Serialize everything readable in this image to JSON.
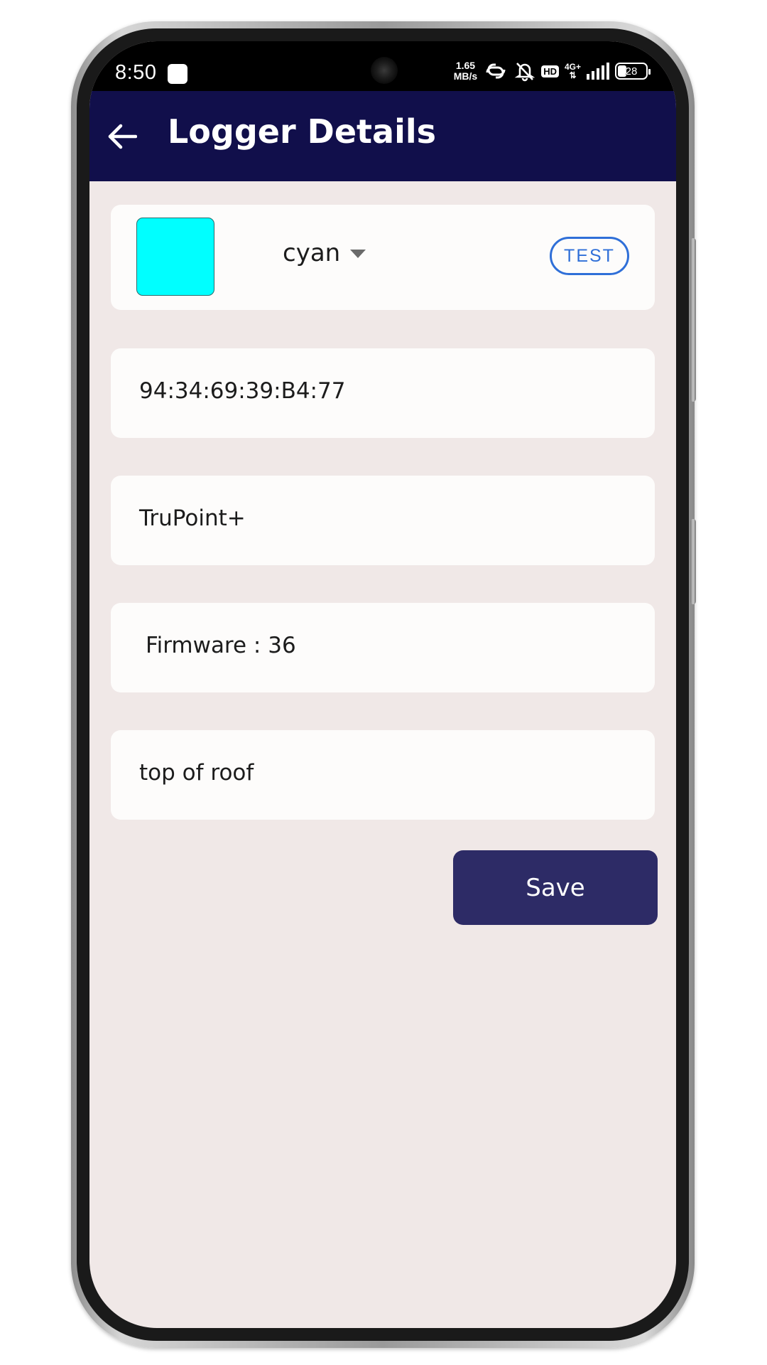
{
  "status_bar": {
    "time": "8:50",
    "net_speed_value": "1.65",
    "net_speed_unit": "MB/s",
    "hd": "HD",
    "network": "4G+",
    "battery": "28"
  },
  "app_bar": {
    "title": "Logger Details",
    "color": "#110f4b"
  },
  "color_row": {
    "swatch_color": "#00ffff",
    "selected_color": "cyan",
    "test_label": "TEST"
  },
  "fields": {
    "mac_address": "94:34:69:39:B4:77",
    "device_name": "TruPoint+",
    "firmware": "Firmware : 36",
    "location": "top of roof"
  },
  "actions": {
    "save_label": "Save"
  },
  "colors": {
    "screen_background": "#f0e8e7",
    "save_button": "#2d2b66",
    "test_outline": "#2f6fd8"
  }
}
